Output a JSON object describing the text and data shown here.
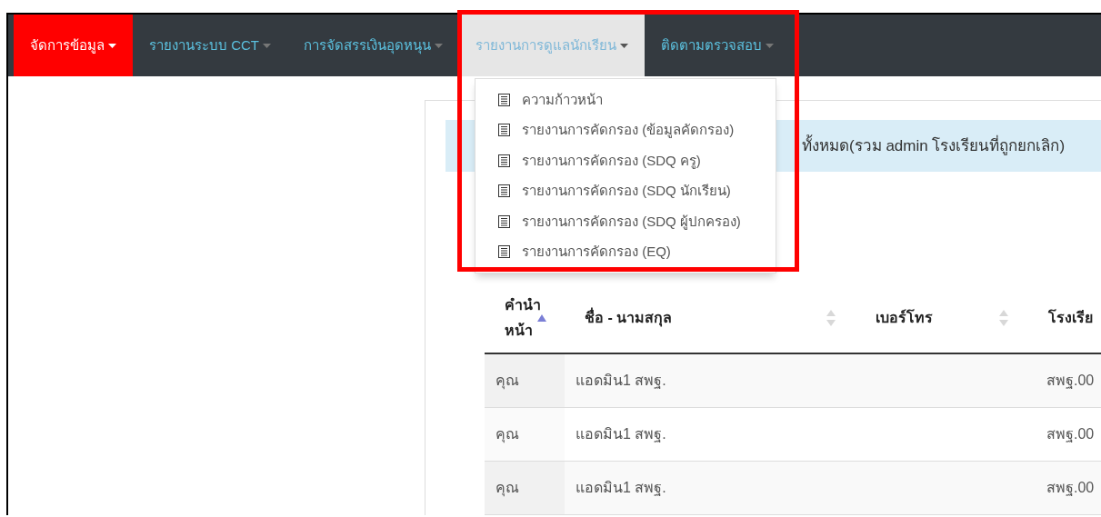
{
  "navbar": {
    "items": [
      {
        "label": "จัดการข้อมูล",
        "selected": true,
        "open": false
      },
      {
        "label": "รายงานระบบ CCT",
        "selected": false,
        "open": false
      },
      {
        "label": "การจัดสรรเงินอุดหนุน",
        "selected": false,
        "open": false
      },
      {
        "label": "รายงานการดูแลนักเรียน",
        "selected": false,
        "open": true
      },
      {
        "label": "ติดตามตรวจสอบ",
        "selected": false,
        "open": false
      }
    ]
  },
  "dropdown": {
    "items": [
      "ความก้าวหน้า",
      "รายงานการคัดกรอง (ข้อมูลคัดกรอง)",
      "รายงานการคัดกรอง (SDQ ครู)",
      "รายงานการคัดกรอง (SDQ นักเรียน)",
      "รายงานการคัดกรอง (SDQ ผู้ปกครอง)",
      "รายงานการคัดกรอง (EQ)"
    ]
  },
  "alert": {
    "text": "ทั้งหมด(รวม admin โรงเรียนที่ถูกยกเลิก)"
  },
  "table": {
    "columns": [
      {
        "label": "คำนำหน้า",
        "sorted": true
      },
      {
        "label": "ชื่อ - นามสกุล",
        "sorted": false
      },
      {
        "label": "เบอร์โทร",
        "sorted": false
      },
      {
        "label": "โรงเรีย"
      }
    ],
    "rows": [
      {
        "prefix": "คุณ",
        "name": "แอดมิน1 สพฐ.",
        "school": "สพฐ.00"
      },
      {
        "prefix": "คุณ",
        "name": "แอดมิน1 สพฐ.",
        "school": "สพฐ.00"
      },
      {
        "prefix": "คุณ",
        "name": "แอดมิน1 สพฐ.",
        "school": "สพฐ.00"
      }
    ]
  }
}
